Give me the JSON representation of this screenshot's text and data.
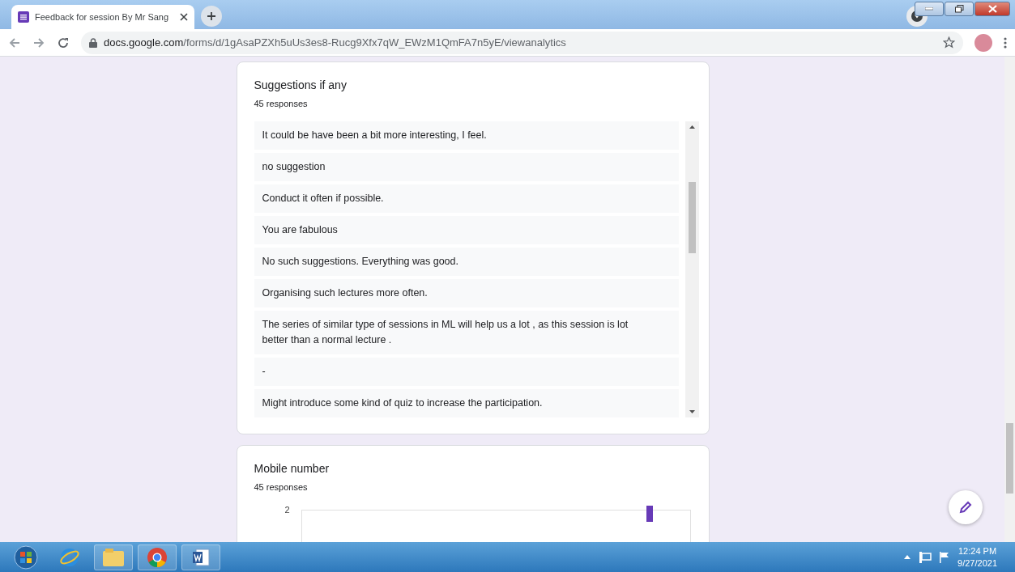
{
  "browser": {
    "tabs": [
      {
        "title": "Feedback for session By Mr Sang",
        "selected": true
      }
    ],
    "url_host": "docs.google.com",
    "url_path": "/forms/d/1gAsaPZXh5uUs3es8-Rucg9Xfx7qW_EWzM1QmFA7n5yE/viewanalytics"
  },
  "questions": [
    {
      "kind": "text",
      "title": "Suggestions if any",
      "count": "45 responses",
      "responses": [
        "It could be have been a bit more interesting, I feel.",
        "no suggestion",
        "Conduct it often if possible.",
        "You are fabulous",
        "No such suggestions. Everything was good.",
        "Organising such lectures more often.",
        "The series of similar type of sessions in ML will help us a lot , as this session is lot better than a normal lecture .",
        "-",
        "Might introduce some kind of quiz to increase the participation."
      ]
    },
    {
      "kind": "bars",
      "title": "Mobile number",
      "count": "45 responses",
      "y_tick": "2"
    }
  ],
  "taskbar": {
    "time": "12:24 PM",
    "date": "9/27/2021"
  }
}
